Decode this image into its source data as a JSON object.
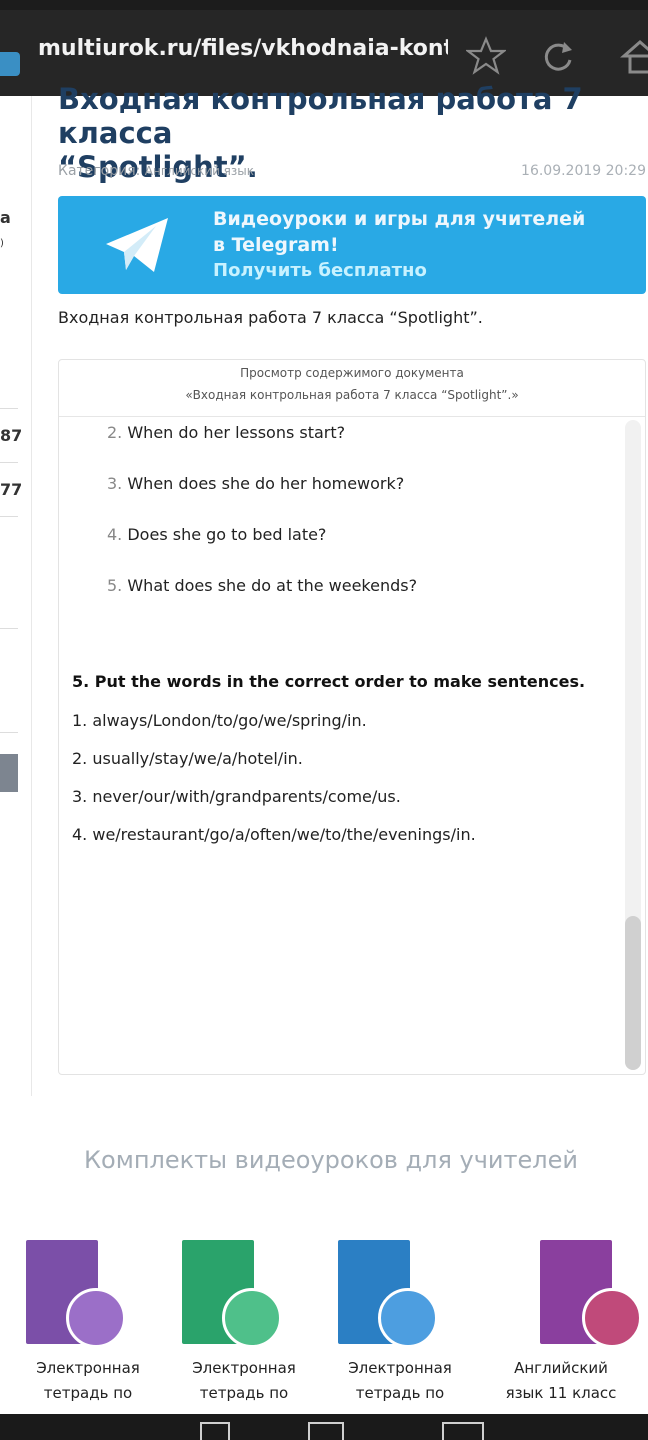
{
  "browser": {
    "url": "multiurok.ru/files/vkhodnaia-kontr..."
  },
  "left_strip": {
    "frag_a": "а",
    "num_1": "87",
    "num_2": "77"
  },
  "article": {
    "title_line1": "Входная контрольная работа 7 класса",
    "title_line2": "“Spotlight”.",
    "category_label": "Категория:",
    "category_value": "Английский язык",
    "date": "16.09.2019 20:29",
    "description": "Входная контрольная работа 7 класса “Spotlight”."
  },
  "banner": {
    "line1": "Видеоуроки и игры для учителей",
    "line2": "в Telegram!",
    "line3": "Получить бесплатно"
  },
  "document": {
    "header_line1": "Просмотр содержимого документа",
    "header_line2": "«Входная контрольная работа 7 класса “Spotlight”.»",
    "questions": [
      {
        "num": "2.",
        "text": "When do her lessons start?"
      },
      {
        "num": "3.",
        "text": "When does she do her homework?"
      },
      {
        "num": "4.",
        "text": "Does she go to bed late?"
      },
      {
        "num": "5.",
        "text": "What does she do at the weekends?"
      }
    ],
    "task_heading": "5. Put the words in the correct order to make sentences.",
    "task_items": [
      "1. always/London/to/go/we/spring/in.",
      "2. usually/stay/we/a/hotel/in.",
      "3. never/our/with/grandparents/come/us.",
      "4. we/restaurant/go/a/often/we/to/the/evenings/in."
    ]
  },
  "kits": {
    "title": "Комплекты видеоуроков для учителей",
    "products": [
      {
        "line1": "Электронная",
        "line2": "тетрадь по",
        "color": "#7b4fa8"
      },
      {
        "line1": "Электронная",
        "line2": "тетрадь по",
        "color": "#2aa36b"
      },
      {
        "line1": "Электронная",
        "line2": "тетрадь по",
        "color": "#2b7fc4"
      },
      {
        "line1": "Английский",
        "line2": "язык 11 класс",
        "color": "#8a3f9e"
      }
    ]
  },
  "colors": {
    "title": "#1f3f62",
    "banner": "#29a9e5",
    "browser_bar": "#262626"
  }
}
